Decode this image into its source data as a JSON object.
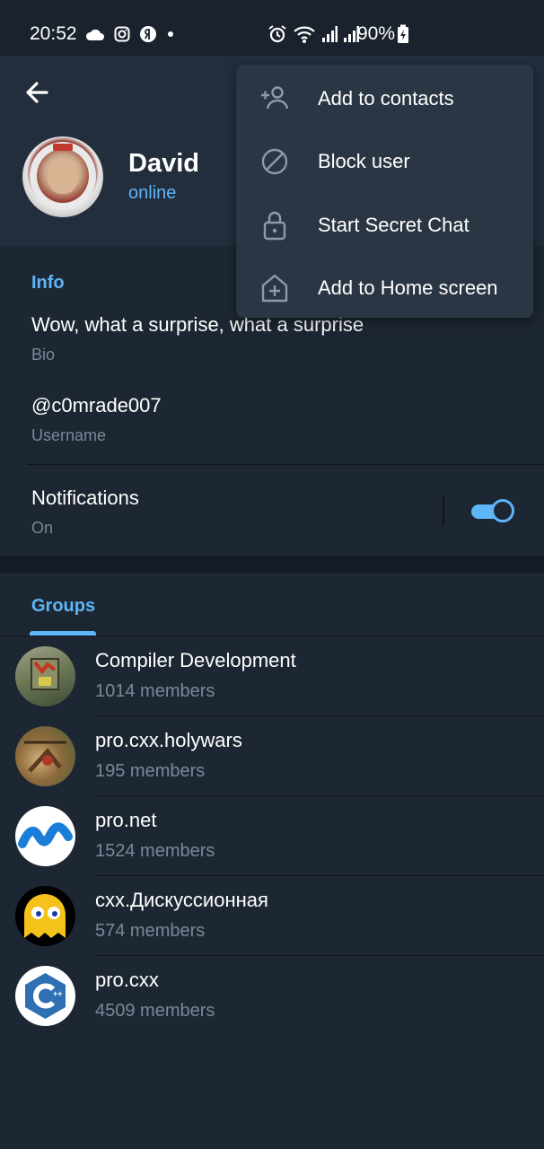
{
  "status_bar": {
    "time": "20:52",
    "battery": "90%"
  },
  "profile": {
    "name": "David",
    "status": "online"
  },
  "info": {
    "title": "Info",
    "bio": "Wow, what a surprise, what a surprise",
    "bio_label": "Bio",
    "username": "@c0mrade007",
    "username_label": "Username",
    "notifications": "Notifications",
    "notifications_state": "On",
    "notifications_enabled": true
  },
  "tabs": {
    "groups": "Groups"
  },
  "groups": [
    {
      "name": "Compiler Development",
      "members": "1014 members"
    },
    {
      "name": "pro.cxx.holywars",
      "members": "195 members"
    },
    {
      "name": "pro.net",
      "members": "1524 members"
    },
    {
      "name": "cxx.Дискуссионная",
      "members": "574 members"
    },
    {
      "name": "pro.cxx",
      "members": "4509 members"
    }
  ],
  "menu": {
    "items": [
      {
        "label": "Add to contacts",
        "icon": "add-contact-icon"
      },
      {
        "label": "Block user",
        "icon": "block-icon"
      },
      {
        "label": "Start Secret Chat",
        "icon": "lock-icon"
      },
      {
        "label": "Add to Home screen",
        "icon": "home-add-icon"
      }
    ]
  },
  "colors": {
    "accent": "#5eb5f7",
    "background": "#1d2733",
    "header": "#232e3c",
    "menu": "#2b3644",
    "secondary_text": "#7b8896"
  }
}
